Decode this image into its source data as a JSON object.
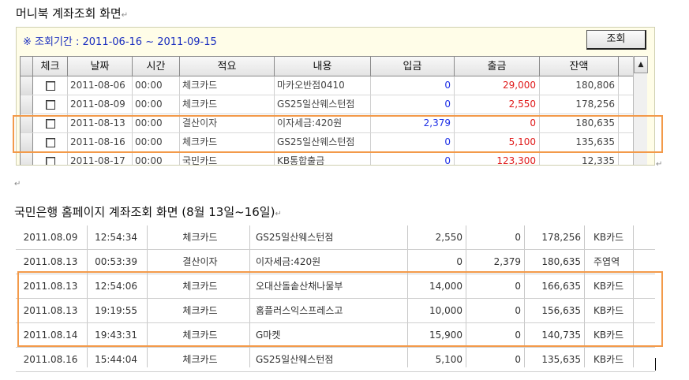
{
  "section1": {
    "heading": "머니북 계좌조회 화면",
    "period_label": "※ 조회기간 : 2011-06-16 ~ 2011-09-15",
    "query_button": "조회",
    "columns": [
      "체크",
      "날짜",
      "시간",
      "적요",
      "내용",
      "입금",
      "출금",
      "잔액"
    ],
    "rows": [
      {
        "date": "2011-08-06",
        "time": "00:00",
        "memo": "체크카드",
        "desc": "마카오반점0410",
        "deposit": "0",
        "withdraw": "29,000",
        "balance": "180,806"
      },
      {
        "date": "2011-08-09",
        "time": "00:00",
        "memo": "체크카드",
        "desc": "GS25일산웨스턴점",
        "deposit": "0",
        "withdraw": "2,550",
        "balance": "178,256"
      },
      {
        "date": "2011-08-13",
        "time": "00:00",
        "memo": "결산이자",
        "desc": "이자세금:420원",
        "deposit": "2,379",
        "withdraw": "0",
        "balance": "180,635"
      },
      {
        "date": "2011-08-16",
        "time": "00:00",
        "memo": "체크카드",
        "desc": "GS25일산웨스턴점",
        "deposit": "0",
        "withdraw": "5,100",
        "balance": "135,635"
      },
      {
        "date": "2011-08-17",
        "time": "00:00",
        "memo": "국민카드",
        "desc": "KB통합출금",
        "deposit": "0",
        "withdraw": "123,300",
        "balance": "12,335"
      }
    ],
    "highlight_color": "#f39a4a"
  },
  "section2": {
    "heading": "국민은행 홈페이지 계좌조회 화면 (8월 13일~16일)",
    "rows": [
      {
        "date": "2011.08.09",
        "time": "12:54:34",
        "memo": "체크카드",
        "desc": "GS25일산웨스턴점",
        "withdraw": "2,550",
        "deposit": "0",
        "balance": "178,256",
        "note": "KB카드"
      },
      {
        "date": "2011.08.13",
        "time": "00:53:39",
        "memo": "결산이자",
        "desc": "이자세금:420원",
        "withdraw": "0",
        "deposit": "2,379",
        "balance": "180,635",
        "note": "주엽역"
      },
      {
        "date": "2011.08.13",
        "time": "12:54:06",
        "memo": "체크카드",
        "desc": "오대산돌솥산채나물부",
        "withdraw": "14,000",
        "deposit": "0",
        "balance": "166,635",
        "note": "KB카드"
      },
      {
        "date": "2011.08.13",
        "time": "19:19:55",
        "memo": "체크카드",
        "desc": "홈플러스익스프레스고",
        "withdraw": "10,000",
        "deposit": "0",
        "balance": "156,635",
        "note": "KB카드"
      },
      {
        "date": "2011.08.14",
        "time": "19:43:31",
        "memo": "체크카드",
        "desc": "G마켓",
        "withdraw": "15,900",
        "deposit": "0",
        "balance": "140,735",
        "note": "KB카드"
      },
      {
        "date": "2011.08.16",
        "time": "15:44:04",
        "memo": "체크카드",
        "desc": "GS25일산웨스턴점",
        "withdraw": "5,100",
        "deposit": "0",
        "balance": "135,635",
        "note": "KB카드"
      }
    ]
  }
}
